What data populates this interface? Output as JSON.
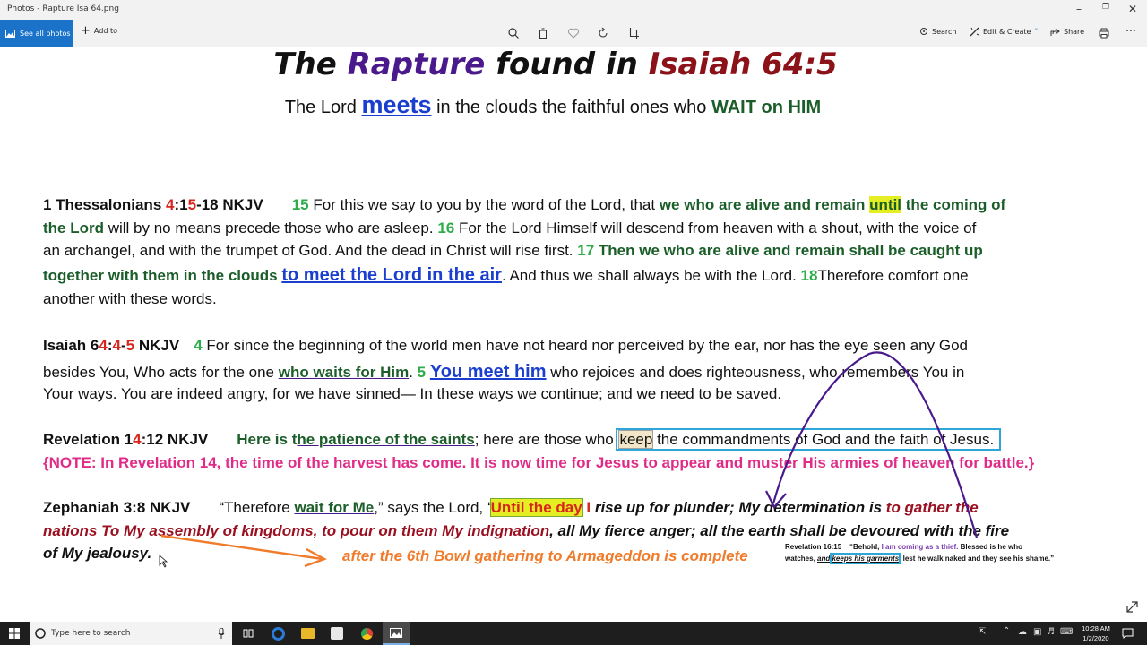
{
  "window": {
    "title": "Photos - Rapture Isa 64.png"
  },
  "toolbar": {
    "see_all": "See all photos",
    "add_to": "Add to",
    "search": "Search",
    "edit_create": "Edit & Create",
    "share": "Share"
  },
  "slide": {
    "title_parts": [
      "The",
      "Rapture",
      "found in",
      "Isaiah 64:5"
    ],
    "subtitle_parts": [
      "The Lord",
      "meets",
      "in the clouds the faithful ones who",
      "WAIT on HIM"
    ],
    "thess": {
      "ref_a": "1 Thessalonians ",
      "ref_b": "4",
      "ref_c": ":1",
      "ref_d": "5",
      "ref_e": "-18 NKJV",
      "l1a": "15",
      "l1b": " For this we say to you by the word of the Lord, that ",
      "l1c": "we who are alive and remain ",
      "l1d": "until",
      "l1e": " the coming of",
      "l2a": "the Lord",
      "l2b": " will by no means precede those who are asleep. ",
      "l2c": "16",
      "l2d": " For the Lord Himself will descend from heaven with a shout, with the voice of",
      "l3a": "an archangel, and with the trumpet of God. And the dead in Christ will rise first. ",
      "l3b": "17",
      "l3c": " Then we who are alive and remain shall be caught up",
      "l4a": "together with them in the clouds",
      "l4b": "to meet the Lord in the air",
      "l4c": ". And thus we shall always be with the Lord.  ",
      "l4d": "18",
      "l4e": "Therefore comfort one",
      "l5": "another with these words."
    },
    "isaiah": {
      "ref_a": "Isaiah 6",
      "ref_b": "4",
      "ref_c": ":",
      "ref_d": "4",
      "ref_e": "-",
      "ref_f": "5",
      "ref_g": " NKJV",
      "l1a": "4",
      "l1b": " For since the beginning of the world men have not heard nor perceived by the ear, nor has the eye seen any God",
      "l2a": "besides You, Who acts for the one ",
      "l2b": "who waits for Him",
      "l2c": ". ",
      "l2d": "5",
      "l2e": "You meet him",
      "l2f": " who rejoices and does righteousness, who remembers You in",
      "l3": "Your ways. You are indeed angry, for we have sinned— In these ways we continue; and we need to be saved."
    },
    "rev": {
      "ref_a": "Revelation 1",
      "ref_b": "4",
      "ref_c": ":12 NKJV",
      "l1a": "Here is t",
      "l1b": "he patience of the saints",
      "l1c": "; here are those who ",
      "l1d": "keep",
      "l1e": " the commandments of God and the faith of Jesus.",
      "note": "{NOTE: In Revelation 14, the time of the harvest has come. It is now time for Jesus to appear and muster His armies of heaven for battle.}"
    },
    "zeph": {
      "ref": "Zephaniah 3:8 NKJV",
      "l1a": "“Therefore ",
      "l1b": "wait for Me",
      "l1c": ",” says the Lord, ‘",
      "l1d": "Until the day",
      "l1e": " I",
      "l1f": " rise up for plunder; My determination is ",
      "l1g": "to gather the",
      "l2a": "nations To My assembly of kingdoms, to pour on them My indignation",
      "l2b": ", all My fierce anger; all the earth shall be devoured with the fire",
      "l3": "of My jealousy.",
      "bowl": "after the 6th Bowl gathering to Armageddon is complete"
    },
    "rev16": {
      "a": "Revelation 16:15",
      "b": "“Behold, ",
      "c": "I am coming as a thief.",
      "d": " Blessed is he who",
      "e": "watches, ",
      "f": "and ",
      "g": "keeps his garments",
      "h": ", lest he walk naked and they see his shame.”"
    }
  },
  "taskbar": {
    "search_placeholder": "Type here to search",
    "time": "10:28 AM",
    "date": "1/2/2020"
  },
  "colors": {
    "accent": "#1a73c9",
    "dark_green": "#1c5e2a",
    "purple": "#4a1a8c",
    "dark_red": "#9b1020"
  }
}
